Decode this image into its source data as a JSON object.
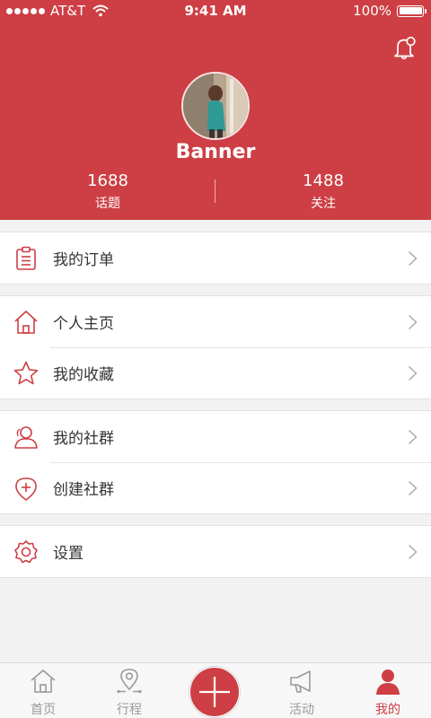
{
  "status_bar": {
    "carrier": "AT&T",
    "time": "9:41 AM",
    "battery": "100%"
  },
  "profile": {
    "name": "Banner",
    "stats": [
      {
        "value": "1688",
        "label": "话题"
      },
      {
        "value": "1488",
        "label": "关注"
      }
    ]
  },
  "menu": {
    "orders": "我的订单",
    "homepage": "个人主页",
    "favorites": "我的收藏",
    "my_groups": "我的社群",
    "create_group": "创建社群",
    "settings": "设置"
  },
  "tabbar": {
    "home": "首页",
    "trip": "行程",
    "activity": "活动",
    "mine": "我的"
  },
  "colors": {
    "accent": "#cd3f44",
    "inactive": "#9a9a9a"
  },
  "icons": [
    "bell-icon",
    "clipboard-icon",
    "house-icon",
    "star-icon",
    "people-icon",
    "shield-plus-icon",
    "gear-icon",
    "chevron-right-icon",
    "location-pin-icon",
    "plus-icon",
    "megaphone-icon",
    "person-icon"
  ]
}
